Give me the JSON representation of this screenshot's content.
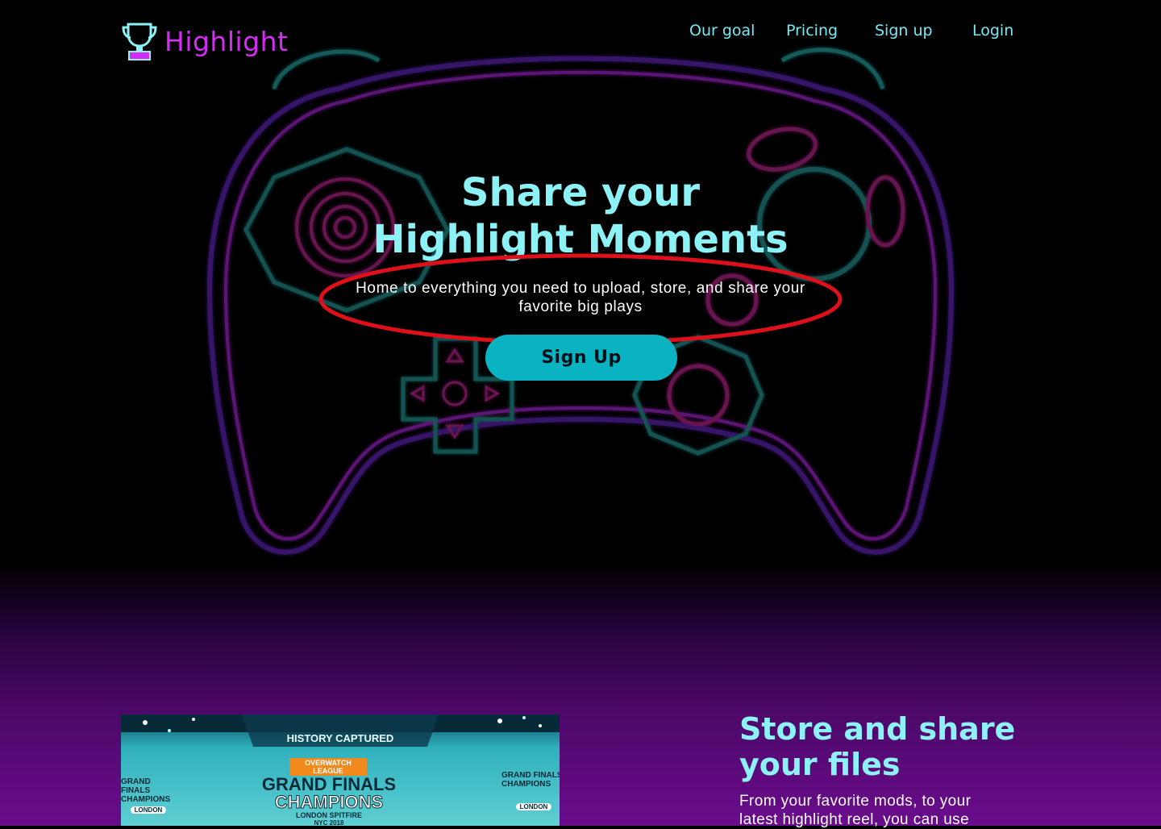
{
  "brand": {
    "name": "Highlight",
    "logo_icon": "trophy-icon"
  },
  "nav": {
    "our_goal": "Our goal",
    "pricing": "Pricing",
    "sign_up": "Sign up",
    "login": "Login"
  },
  "hero": {
    "title_line1": "Share your",
    "title_line2": "Highlight Moments",
    "subtitle": "Home to everything you need to upload, store, and share your favorite big plays",
    "cta_label": "Sign Up"
  },
  "feature": {
    "title_line1": "Store and share",
    "title_line2": "your files",
    "text": "From your favorite mods, to your latest highlight reel, you can use",
    "image": {
      "top_banner": "HISTORY CAPTURED",
      "league": "OVERWATCH LEAGUE",
      "headline1": "GRAND FINALS",
      "headline2": "CHAMPIONS",
      "team": "LONDON SPITFIRE",
      "event": "NYC 2018",
      "side_headline": "GRAND FINALS CHAMPIONS",
      "side_team": "LONDON SPITFIRE",
      "badge": "LONDON"
    }
  },
  "colors": {
    "accent_cyan": "#8cf2f6",
    "brand_magenta": "#d42bf5",
    "cta_teal": "#0ab3c2",
    "annotation_red": "#e0101a"
  }
}
